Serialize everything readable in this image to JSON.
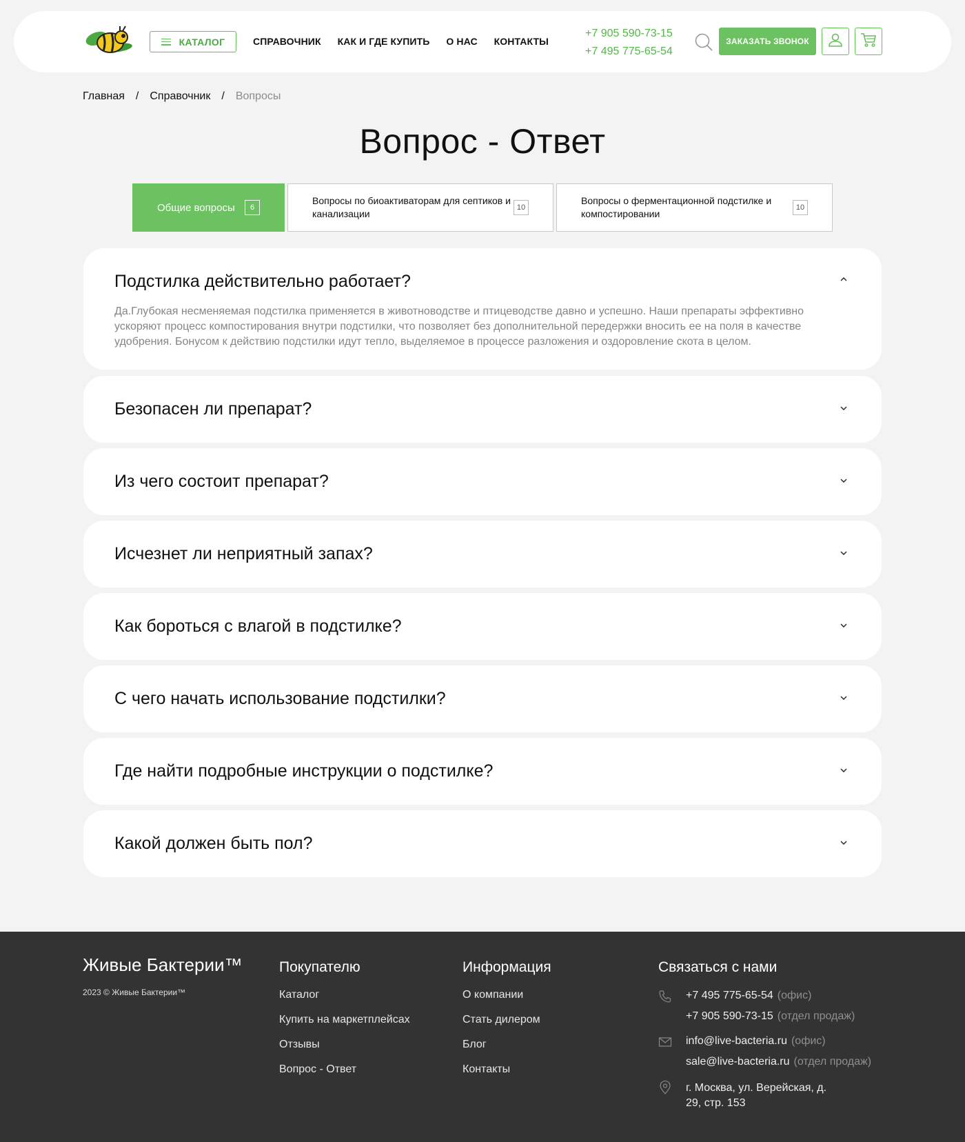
{
  "header": {
    "catalog_label": "КАТАЛОГ",
    "nav": [
      "СПРАВОЧНИК",
      "КАК И ГДЕ КУПИТЬ",
      "О НАС",
      "КОНТАКТЫ"
    ],
    "phones": [
      "+7 905 590-73-15",
      "+7 495 775-65-54"
    ],
    "callback_label": "ЗАКАЗАТЬ ЗВОНОК"
  },
  "breadcrumb": [
    "Главная",
    "Справочник",
    "Вопросы"
  ],
  "page_title": "Вопрос - Ответ",
  "tabs": [
    {
      "label": "Общие вопросы",
      "count": "6",
      "active": true
    },
    {
      "label": "Вопросы по биоактиваторам для септиков и канализации",
      "count": "10"
    },
    {
      "label": "Вопросы о ферментационной подстилке и компостировании",
      "count": "10"
    }
  ],
  "faq": [
    {
      "q": "Подстилка действительно работает?",
      "open": true,
      "a": "Да.Глубокая несменяемая подстилка применяется в животноводстве и птицеводстве давно и успешно. Наши препараты эффективно ускоряют процесс компостирования внутри подстилки, что позволяет без дополнительной передержки вносить ее на поля в качестве удобрения. Бонусом к действию подстилки идут тепло, выделяемое в процессе разложения и оздоровление скота в целом."
    },
    {
      "q": "Безопасен ли препарат?"
    },
    {
      "q": "Из чего состоит препарат?"
    },
    {
      "q": "Исчезнет ли неприятный запах?"
    },
    {
      "q": "Как бороться с влагой в подстилке?"
    },
    {
      "q": "С чего начать использование подстилки?"
    },
    {
      "q": "Где найти подробные инструкции о подстилке?"
    },
    {
      "q": "Какой должен быть пол?"
    }
  ],
  "footer": {
    "brand": "Живые Бактерии™",
    "copyright": "2023 © Живые Бактерии™",
    "buyer": {
      "title": "Покупателю",
      "links": [
        "Каталог",
        "Купить на маркетплейсах",
        "Отзывы",
        "Вопрос - Ответ"
      ]
    },
    "info": {
      "title": "Информация",
      "links": [
        "О компании",
        "Стать дилером",
        "Блог",
        "Контакты"
      ]
    },
    "contact": {
      "title": "Связаться с нами",
      "phone1": "+7 495 775-65-54",
      "phone1_note": "(офис)",
      "phone2": "+7 905 590-73-15",
      "phone2_note": "(отдел продаж)",
      "email1": "info@live-bacteria.ru",
      "email1_note": "(офис)",
      "email2": "sale@live-bacteria.ru",
      "email2_note": "(отдел продаж)",
      "address_line1": "г. Москва, ул. Верейская, д.",
      "address_line2": "29, стр. 153"
    }
  },
  "colors": {
    "accent": "#6cc260",
    "footer_bg": "#333333",
    "page_bg": "#f3f3f3"
  }
}
